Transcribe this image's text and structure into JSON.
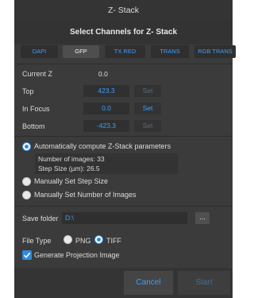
{
  "window": {
    "title": "Z- Stack"
  },
  "channels": {
    "heading": "Select Channels for Z- Stack",
    "items": [
      {
        "label": "DAPI"
      },
      {
        "label": "GFP"
      },
      {
        "label": "TX RED"
      },
      {
        "label": "TRANS"
      },
      {
        "label": "RGB TRANS"
      }
    ],
    "selected": "GFP"
  },
  "positions": {
    "current_z": {
      "label": "Current Z",
      "value": "0.0"
    },
    "top": {
      "label": "Top",
      "value": "423.3",
      "set_label": "Set"
    },
    "in_focus": {
      "label": "In Focus",
      "value": "0.0",
      "set_label": "Set"
    },
    "bottom": {
      "label": "Bottom",
      "value": "-423.3",
      "set_label": "Set"
    }
  },
  "stack_mode": {
    "options": [
      {
        "label": "Automatically compute Z-Stack parameters",
        "selected": true
      },
      {
        "label": "Manually Set Step Size",
        "selected": false
      },
      {
        "label": "Manually Set Number of Images",
        "selected": false
      }
    ],
    "info": {
      "num_images": "Number of images:  33",
      "step_size": "Step Size (µm):  26.5"
    }
  },
  "output": {
    "save_folder_label": "Save folder",
    "save_folder_value": "D:\\",
    "browse_label": "...",
    "file_type_label": "File Type",
    "file_types": [
      {
        "label": "PNG",
        "selected": false
      },
      {
        "label": "TIFF",
        "selected": true
      }
    ],
    "projection_label": "Generate Projection Image",
    "projection_checked": true
  },
  "actions": {
    "cancel_label": "Cancel",
    "start_label": "Start"
  },
  "colors": {
    "accent": "#3aa0ff",
    "background": "#3b3b3b",
    "disabled": "#5b6b7b"
  }
}
